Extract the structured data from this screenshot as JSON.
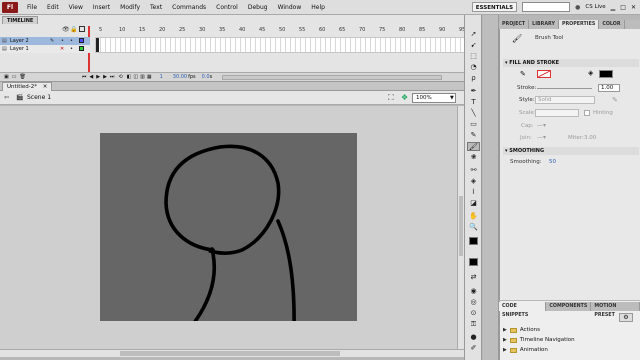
{
  "menubar": {
    "logo": "Fl",
    "items": [
      "File",
      "Edit",
      "View",
      "Insert",
      "Modify",
      "Text",
      "Commands",
      "Control",
      "Debug",
      "Window",
      "Help"
    ],
    "workspace": "ESSENTIALS",
    "cs_live": "CS Live"
  },
  "timeline": {
    "tab": "TIMELINE",
    "layers": [
      "Layer 2",
      "Layer 1"
    ],
    "frame_numbers": [
      "5",
      "10",
      "15",
      "20",
      "25",
      "30",
      "35",
      "40",
      "45",
      "50",
      "55",
      "60",
      "65",
      "70",
      "75",
      "80",
      "85",
      "90",
      "95"
    ],
    "current_frame": "1",
    "fps": "30.00",
    "fps_unit": "fps",
    "time": "0.0",
    "time_unit": "s"
  },
  "document": {
    "tab": "Untitled-2*",
    "scene": "Scene 1",
    "zoom": "100%"
  },
  "panels": {
    "tabs": [
      "PROJECT",
      "LIBRARY",
      "PROPERTIES",
      "COLOR"
    ],
    "active_tab": "PROPERTIES",
    "tool_name": "Brush Tool",
    "fill_stroke_header": "FILL AND STROKE",
    "stroke_label": "Stroke:",
    "stroke_value": "1.00",
    "style_label": "Style:",
    "style_value": "Solid",
    "scale_label": "Scale:",
    "hinting_label": "Hinting",
    "cap_label": "Cap:",
    "join_label": "Join:",
    "miter_label": "Miter:",
    "miter_value": "3.00",
    "smoothing_header": "SMOOTHING",
    "smoothing_label": "Smoothing:",
    "smoothing_value": "50",
    "fill_color": "#000000",
    "stroke_color": "#ff0000"
  },
  "snippets": {
    "tabs": [
      "CODE SNIPPETS",
      "COMPONENTS",
      "MOTION PRESET"
    ],
    "folders": [
      "Actions",
      "Timeline Navigation",
      "Animation"
    ]
  },
  "colors": {
    "stage": "#666666",
    "brush_stroke": "#000000"
  }
}
